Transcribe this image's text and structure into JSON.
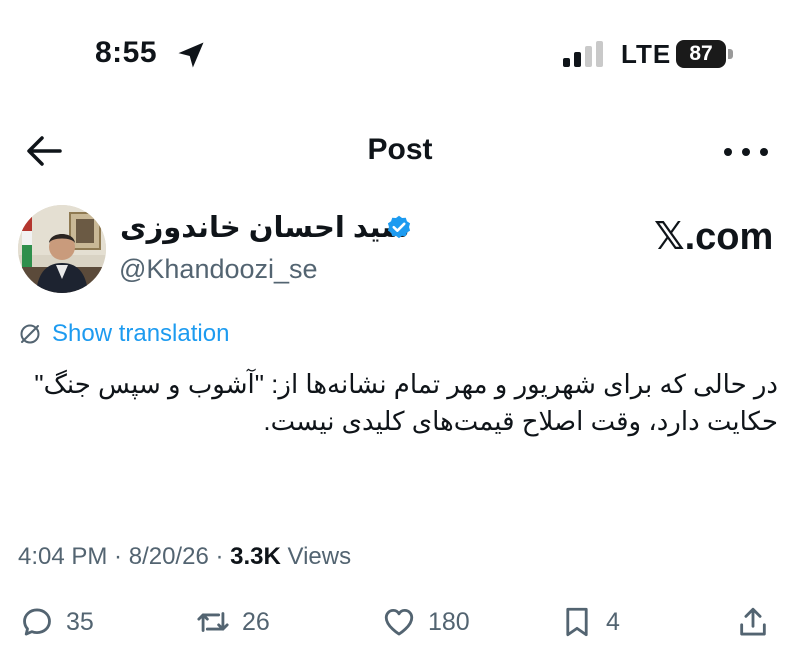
{
  "status_bar": {
    "time": "8:55",
    "network": "LTE",
    "battery": "87"
  },
  "nav": {
    "title": "Post"
  },
  "author": {
    "display_name": "سید احسان خاندوزی",
    "username": "@Khandoozi_se"
  },
  "watermark": "𝕏.com",
  "translate": {
    "label": "Show translation"
  },
  "tweet": {
    "text": "در حالی که برای شهریور و مهر تمام نشانه‌ها از: \"آشوب و سپس جنگ\" حکایت دارد، وقت اصلاح قیمت‌های کلیدی نیست."
  },
  "meta": {
    "time": "4:04 PM",
    "sep1": " · ",
    "date": "8/20/26",
    "sep2": " · ",
    "views_count": "3.3K",
    "views_label": " Views"
  },
  "actions": {
    "replies": "35",
    "reposts": "26",
    "likes": "180",
    "bookmarks": "4"
  },
  "colors": {
    "accent": "#1d9bf0",
    "secondary_text": "#536471",
    "primary_text": "#0f1419"
  }
}
